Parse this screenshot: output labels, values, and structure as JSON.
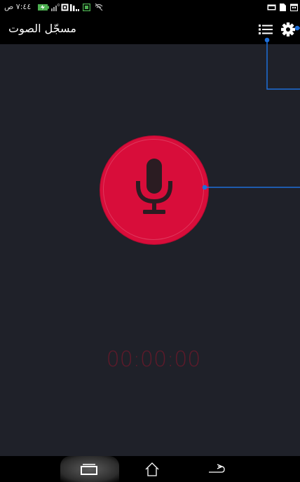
{
  "status_bar": {
    "time": "٧:٤٤ ص"
  },
  "app_bar": {
    "title": "مسجّل الصوت",
    "list_icon": "list-icon",
    "settings_icon": "gear-icon"
  },
  "main": {
    "record_icon": "microphone-icon",
    "timer": "00:00:00"
  },
  "nav_bar": {
    "recent_icon": "recent-apps-icon",
    "home_icon": "home-icon",
    "back_icon": "back-icon"
  },
  "colors": {
    "background": "#1f2129",
    "record_button": "#d80d3a",
    "timer_text": "#5e1a2a",
    "callout_line": "#1e6fd9"
  }
}
